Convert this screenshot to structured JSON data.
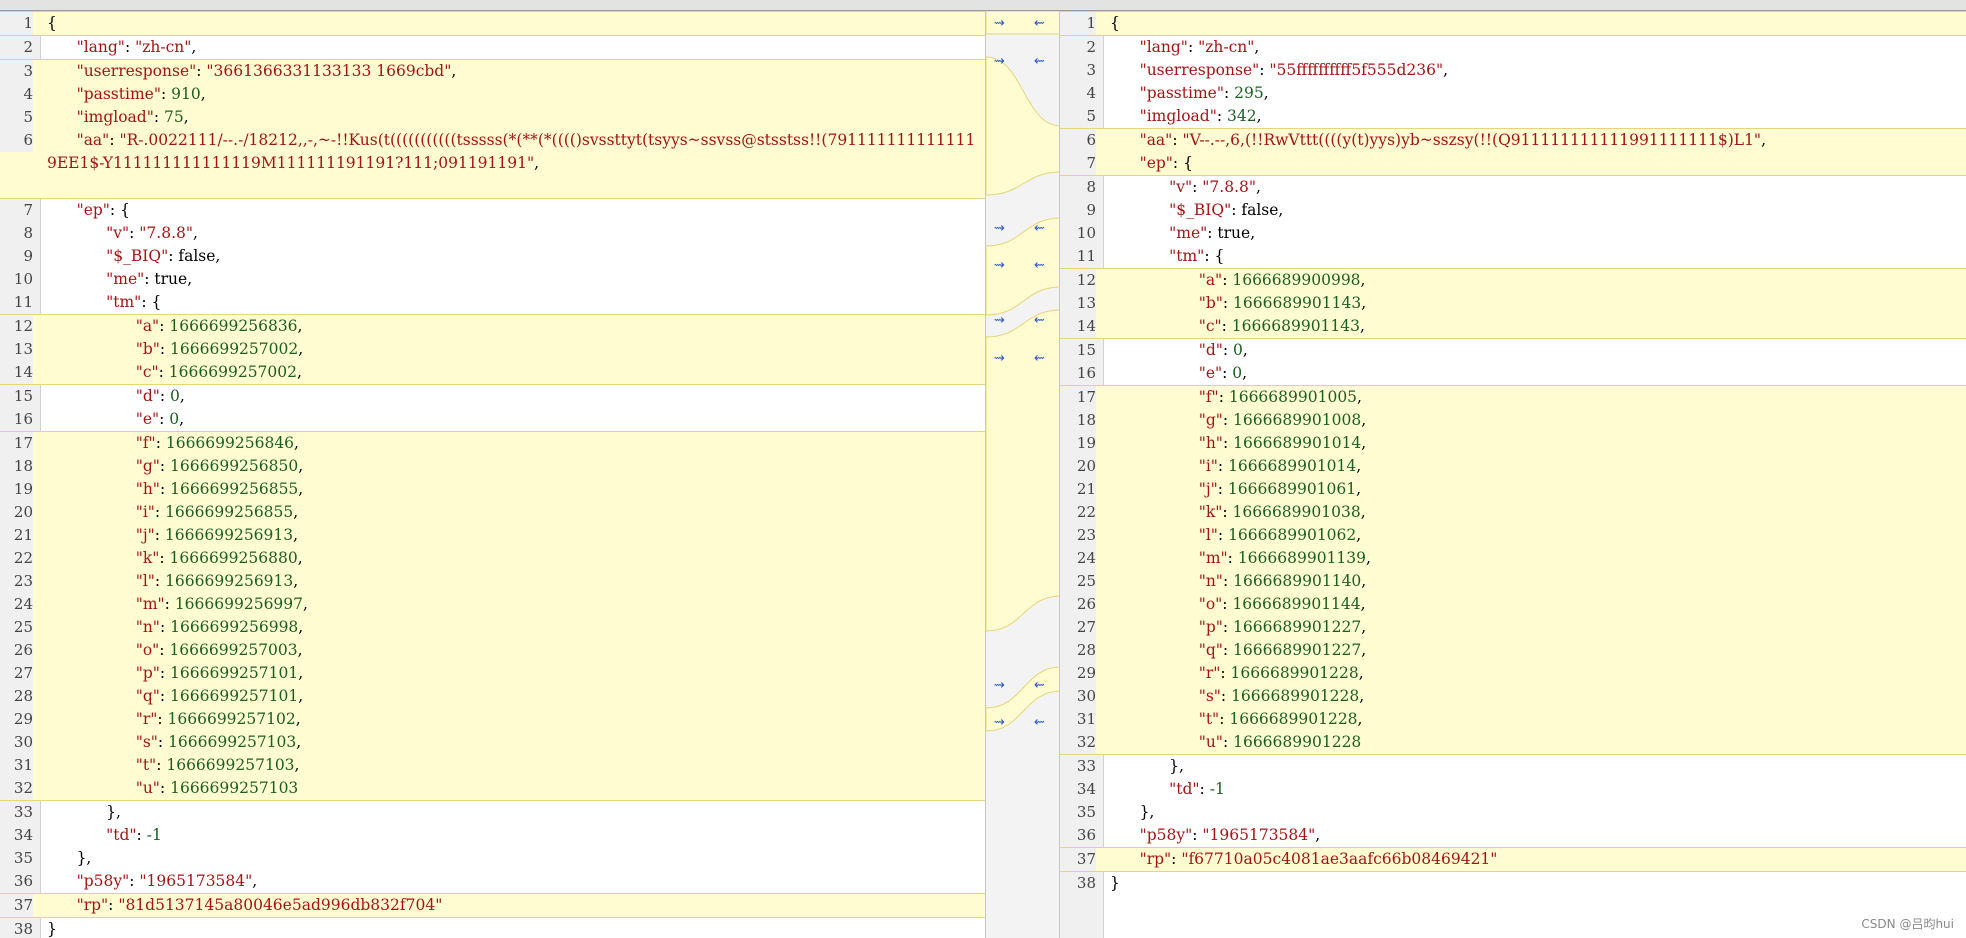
{
  "diff_view": {
    "left": {
      "lines": [
        {
          "n": "1",
          "text": "{",
          "chg": true
        },
        {
          "n": "2",
          "text": "      \"lang\": \"zh-cn\","
        },
        {
          "n": "3",
          "text": "      \"userresponse\": \"3661366331133133 1669cbd\",",
          "chg": true
        },
        {
          "n": "4",
          "text": "      \"passtime\": 910,",
          "chg": true
        },
        {
          "n": "5",
          "text": "      \"imgload\": 75,",
          "chg": true
        },
        {
          "n": "6",
          "text": "      \"aa\": \"R-.0022111/--.-/18212,,-,~-!!Kus(t(((((((((((tsssss(*(**(*(((()svssttyt(tsyys~ssvss@stsstss!!(7911111111111119EE1$-Y111111111111119M111111191191?111;091191191\",",
          "chg": true,
          "rows": 3
        },
        {
          "n": "7",
          "text": "      \"ep\": {"
        },
        {
          "n": "8",
          "text": "            \"v\": \"7.8.8\","
        },
        {
          "n": "9",
          "text": "            \"$_BIQ\": false,"
        },
        {
          "n": "10",
          "text": "            \"me\": true,"
        },
        {
          "n": "11",
          "text": "            \"tm\": {"
        },
        {
          "n": "12",
          "text": "                  \"a\": 1666699256836,",
          "chg": true
        },
        {
          "n": "13",
          "text": "                  \"b\": 1666699257002,",
          "chg": true
        },
        {
          "n": "14",
          "text": "                  \"c\": 1666699257002,",
          "chg": true
        },
        {
          "n": "15",
          "text": "                  \"d\": 0,"
        },
        {
          "n": "16",
          "text": "                  \"e\": 0,"
        },
        {
          "n": "17",
          "text": "                  \"f\": 1666699256846,",
          "chg": true
        },
        {
          "n": "18",
          "text": "                  \"g\": 1666699256850,",
          "chg": true
        },
        {
          "n": "19",
          "text": "                  \"h\": 1666699256855,",
          "chg": true
        },
        {
          "n": "20",
          "text": "                  \"i\": 1666699256855,",
          "chg": true
        },
        {
          "n": "21",
          "text": "                  \"j\": 1666699256913,",
          "chg": true
        },
        {
          "n": "22",
          "text": "                  \"k\": 1666699256880,",
          "chg": true
        },
        {
          "n": "23",
          "text": "                  \"l\": 1666699256913,",
          "chg": true
        },
        {
          "n": "24",
          "text": "                  \"m\": 1666699256997,",
          "chg": true
        },
        {
          "n": "25",
          "text": "                  \"n\": 1666699256998,",
          "chg": true
        },
        {
          "n": "26",
          "text": "                  \"o\": 1666699257003,",
          "chg": true
        },
        {
          "n": "27",
          "text": "                  \"p\": 1666699257101,",
          "chg": true
        },
        {
          "n": "28",
          "text": "                  \"q\": 1666699257101,",
          "chg": true
        },
        {
          "n": "29",
          "text": "                  \"r\": 1666699257102,",
          "chg": true
        },
        {
          "n": "30",
          "text": "                  \"s\": 1666699257103,",
          "chg": true
        },
        {
          "n": "31",
          "text": "                  \"t\": 1666699257103,",
          "chg": true
        },
        {
          "n": "32",
          "text": "                  \"u\": 1666699257103",
          "chg": true
        },
        {
          "n": "33",
          "text": "            },"
        },
        {
          "n": "34",
          "text": "            \"td\": -1"
        },
        {
          "n": "35",
          "text": "      },"
        },
        {
          "n": "36",
          "text": "      \"p58y\": \"1965173584\","
        },
        {
          "n": "37",
          "text": "      \"rp\": \"81d5137145a80046e5ad996db832f704\"",
          "chg": true
        },
        {
          "n": "38",
          "text": "}"
        }
      ]
    },
    "right": {
      "lines": [
        {
          "n": "1",
          "text": "{",
          "chg": true
        },
        {
          "n": "2",
          "text": "      \"lang\": \"zh-cn\","
        },
        {
          "n": "3",
          "text": "      \"userresponse\": \"55ffffffffff5f555d236\","
        },
        {
          "n": "4",
          "text": "      \"passtime\": 295,"
        },
        {
          "n": "5",
          "text": "      \"imgload\": 342,"
        },
        {
          "n": "6",
          "text": "      \"aa\": \"V--.--,6,(!!RwVttt((((y(t)yys)yb~sszsy(!!(Q911111111111991111111$)L1\",",
          "chg": true,
          "chgTop": true
        },
        {
          "n": "7",
          "text": "      \"ep\": {",
          "chg": true
        },
        {
          "n": "8",
          "text": "            \"v\": \"7.8.8\","
        },
        {
          "n": "9",
          "text": "            \"$_BIQ\": false,"
        },
        {
          "n": "10",
          "text": "            \"me\": true,"
        },
        {
          "n": "11",
          "text": "            \"tm\": {"
        },
        {
          "n": "12",
          "text": "                  \"a\": 1666689900998,",
          "chg": true
        },
        {
          "n": "13",
          "text": "                  \"b\": 1666689901143,",
          "chg": true
        },
        {
          "n": "14",
          "text": "                  \"c\": 1666689901143,",
          "chg": true
        },
        {
          "n": "15",
          "text": "                  \"d\": 0,"
        },
        {
          "n": "16",
          "text": "                  \"e\": 0,"
        },
        {
          "n": "17",
          "text": "                  \"f\": 1666689901005,",
          "chg": true
        },
        {
          "n": "18",
          "text": "                  \"g\": 1666689901008,",
          "chg": true
        },
        {
          "n": "19",
          "text": "                  \"h\": 1666689901014,",
          "chg": true
        },
        {
          "n": "20",
          "text": "                  \"i\": 1666689901014,",
          "chg": true
        },
        {
          "n": "21",
          "text": "                  \"j\": 1666689901061,",
          "chg": true
        },
        {
          "n": "22",
          "text": "                  \"k\": 1666689901038,",
          "chg": true
        },
        {
          "n": "23",
          "text": "                  \"l\": 1666689901062,",
          "chg": true
        },
        {
          "n": "24",
          "text": "                  \"m\": 1666689901139,",
          "chg": true
        },
        {
          "n": "25",
          "text": "                  \"n\": 1666689901140,",
          "chg": true
        },
        {
          "n": "26",
          "text": "                  \"o\": 1666689901144,",
          "chg": true
        },
        {
          "n": "27",
          "text": "                  \"p\": 1666689901227,",
          "chg": true
        },
        {
          "n": "28",
          "text": "                  \"q\": 1666689901227,",
          "chg": true
        },
        {
          "n": "29",
          "text": "                  \"r\": 1666689901228,",
          "chg": true
        },
        {
          "n": "30",
          "text": "                  \"s\": 1666689901228,",
          "chg": true
        },
        {
          "n": "31",
          "text": "                  \"t\": 1666689901228,",
          "chg": true
        },
        {
          "n": "32",
          "text": "                  \"u\": 1666689901228",
          "chg": true
        },
        {
          "n": "33",
          "text": "            },"
        },
        {
          "n": "34",
          "text": "            \"td\": -1"
        },
        {
          "n": "35",
          "text": "      },"
        },
        {
          "n": "36",
          "text": "      \"p58y\": \"1965173584\","
        },
        {
          "n": "37",
          "text": "      \"rp\": \"f67710a05c4081ae3aafc66b08469421\"",
          "chg": true
        },
        {
          "n": "38",
          "text": "}"
        }
      ]
    },
    "arrows": {
      "copy_right_glyph": "⇝",
      "copy_left_glyph": "⇜"
    }
  },
  "watermark": "CSDN @吕昀hui",
  "colors": {
    "change_bg": "#fffcd2",
    "change_border": "#e6d57a",
    "string": "#a31515",
    "number": "#1b5e20",
    "arrow": "#2f59c7"
  }
}
